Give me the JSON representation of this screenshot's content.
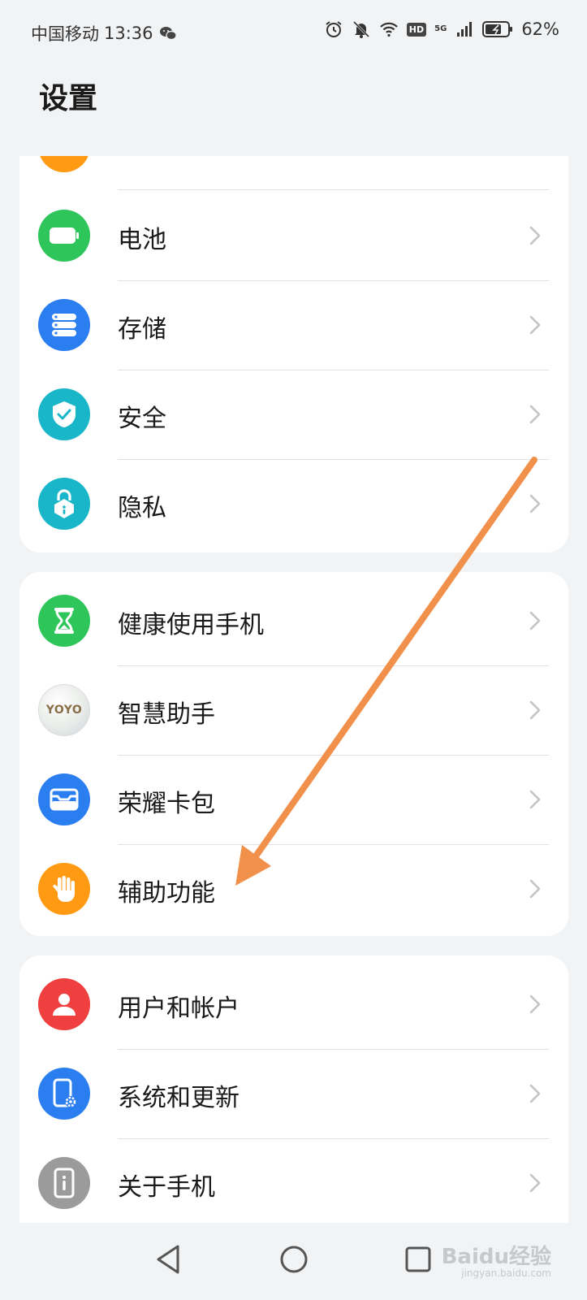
{
  "status_bar": {
    "carrier": "中国移动",
    "time": "13:36",
    "battery_percent": "62%",
    "network": "5G",
    "hd_label": "HD"
  },
  "page": {
    "title": "设置"
  },
  "card1": {
    "items": [
      {
        "label": "电池",
        "icon": "battery-icon",
        "color": "#2ec55b"
      },
      {
        "label": "存储",
        "icon": "storage-icon",
        "color": "#2a7ef0"
      },
      {
        "label": "安全",
        "icon": "shield-check-icon",
        "color": "#18b6c8"
      },
      {
        "label": "隐私",
        "icon": "privacy-lock-icon",
        "color": "#18b6c8"
      }
    ]
  },
  "card2": {
    "items": [
      {
        "label": "健康使用手机",
        "icon": "hourglass-icon",
        "color": "#2ec55b"
      },
      {
        "label": "智慧助手",
        "icon": "yoyo-icon",
        "icon_text": "YOYO",
        "color": "#e9ece9"
      },
      {
        "label": "荣耀卡包",
        "icon": "wallet-icon",
        "color": "#2a7ef0"
      },
      {
        "label": "辅助功能",
        "icon": "hand-icon",
        "color": "#ff9a12"
      }
    ]
  },
  "card3": {
    "items": [
      {
        "label": "用户和帐户",
        "icon": "user-icon",
        "color": "#ef3f3f"
      },
      {
        "label": "系统和更新",
        "icon": "system-update-icon",
        "color": "#2a7ef0"
      },
      {
        "label": "关于手机",
        "icon": "about-phone-icon",
        "color": "#9b9b9b"
      }
    ]
  },
  "annotation": {
    "color": "#f0904a"
  },
  "watermark": {
    "text": "Baidu经验",
    "sub": "jingyan.baidu.com"
  }
}
